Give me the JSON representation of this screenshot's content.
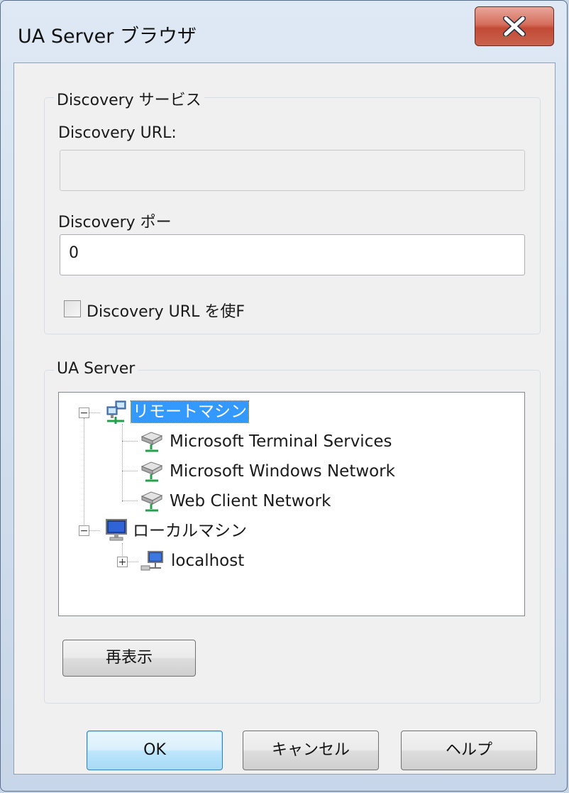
{
  "window": {
    "title": "UA Server ブラウザ",
    "close_symbol": "X"
  },
  "discovery_group": {
    "label": "Discovery サービス",
    "url_label": "Discovery URL:",
    "url_value": "",
    "url_enabled": false,
    "port_label": "Discovery ポー",
    "port_value": "0",
    "use_url_checkbox_label": "Discovery URL を使F",
    "use_url_checked": false
  },
  "server_group": {
    "label": "UA Server",
    "tree": {
      "remote": {
        "label": "リモートマシン",
        "icon": "network-computers-icon",
        "expanded": true,
        "selected": true,
        "children": [
          {
            "label": "Microsoft Terminal Services",
            "icon": "network-server-icon"
          },
          {
            "label": "Microsoft Windows Network",
            "icon": "network-server-icon"
          },
          {
            "label": "Web Client Network",
            "icon": "network-server-icon"
          }
        ]
      },
      "local": {
        "label": "ローカルマシン",
        "icon": "computer-monitor-icon",
        "expanded": true,
        "children": [
          {
            "label": "localhost",
            "icon": "network-computer-icon",
            "expanded": false
          }
        ]
      }
    },
    "refresh_label": "再表示"
  },
  "footer": {
    "ok_label": "OK",
    "cancel_label": "キャンセル",
    "help_label": "ヘルプ"
  },
  "colors": {
    "selection": "#3399ff",
    "window_frame": "#d3e0ef",
    "close_button": "#c9513c",
    "dialog_background": "#f0f0f0"
  }
}
